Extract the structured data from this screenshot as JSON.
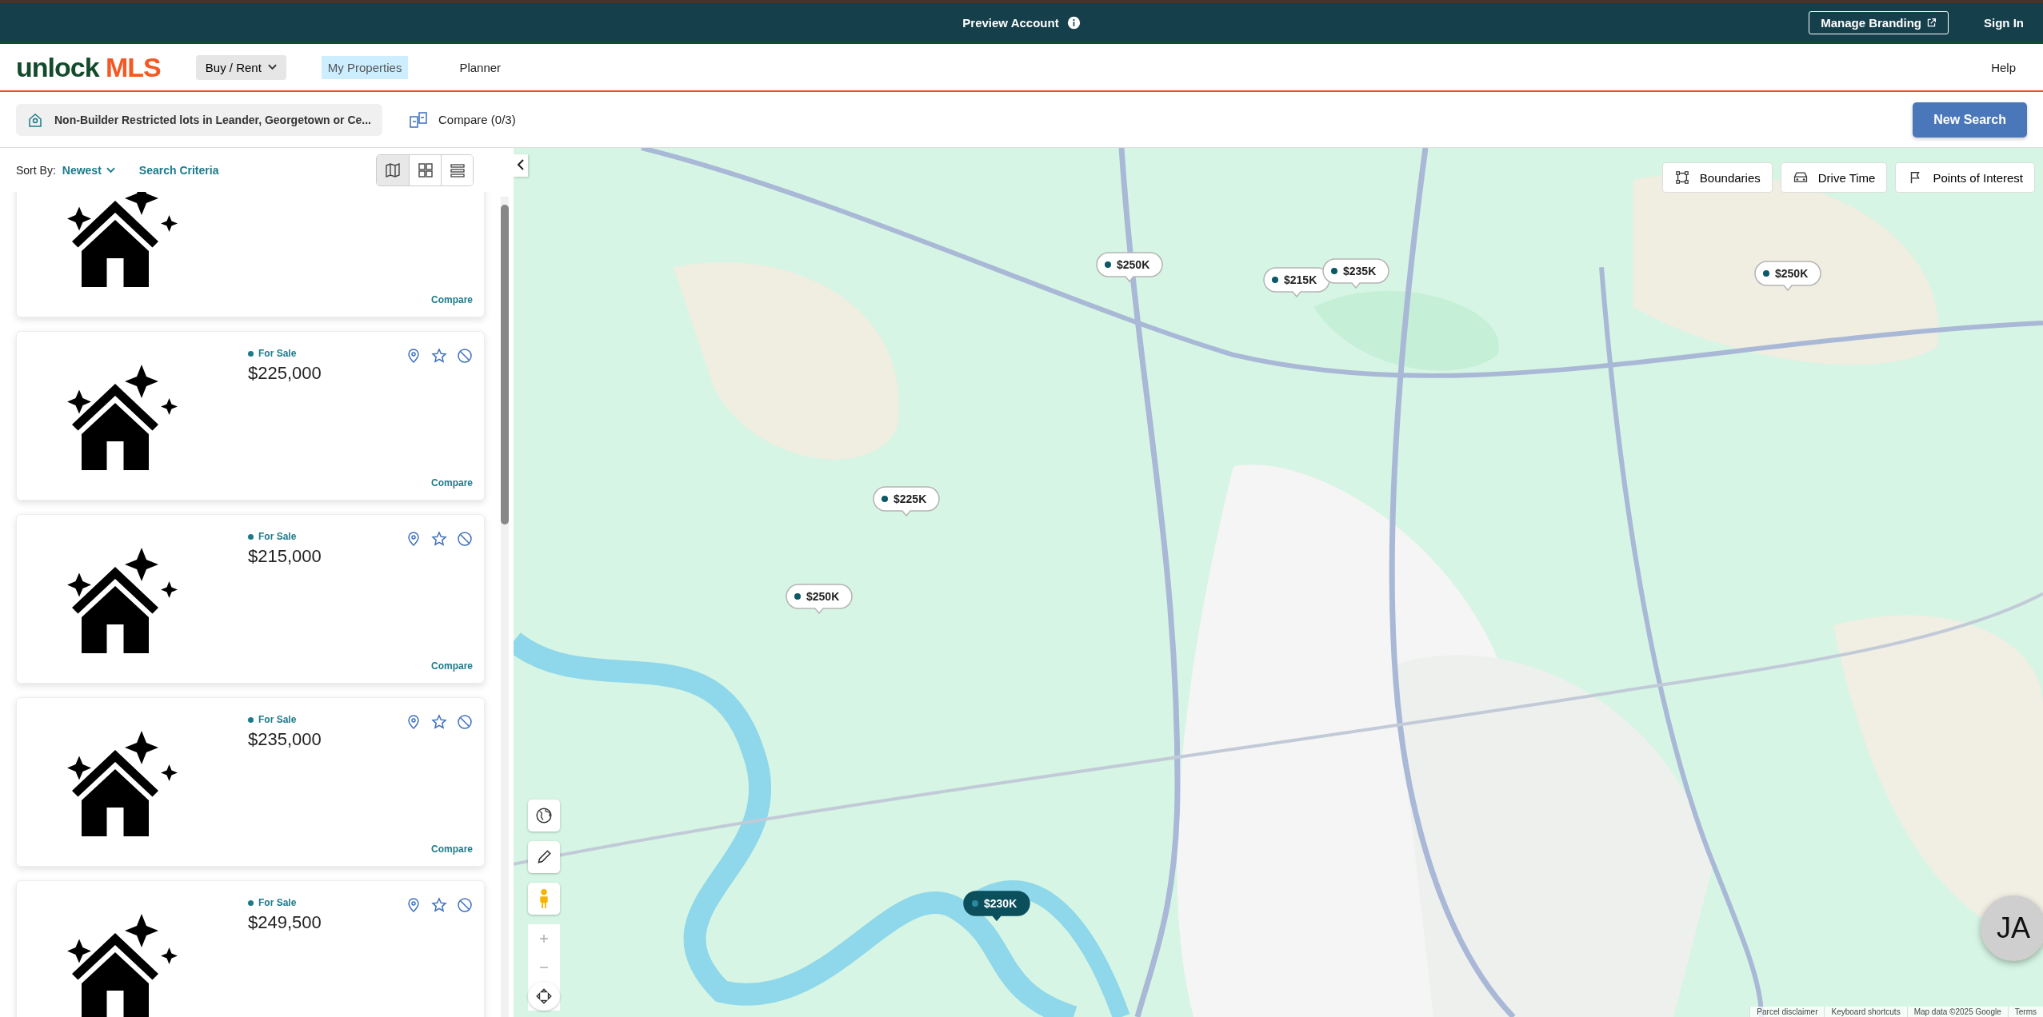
{
  "top_bar": {
    "title": "Preview Account",
    "manage_branding": "Manage Branding",
    "sign_in": "Sign In"
  },
  "nav": {
    "logo_primary": "unlock",
    "logo_accent": "MLS",
    "items": [
      {
        "label": "Buy / Rent",
        "kind": "dropdown",
        "selected": false
      },
      {
        "label": "My Properties",
        "kind": "link",
        "selected": true
      },
      {
        "label": "Planner",
        "kind": "link",
        "selected": false
      }
    ],
    "help": "Help"
  },
  "search_bar": {
    "saved_search": "Non-Builder Restricted lots in Leander, Georgetown or Ce...",
    "compare": "Compare (0/3)",
    "new_search": "New Search"
  },
  "list_header": {
    "sort_label": "Sort By:",
    "sort_value": "Newest",
    "search_criteria": "Search Criteria",
    "views": [
      {
        "kind": "map",
        "selected": true
      },
      {
        "kind": "grid",
        "selected": false
      },
      {
        "kind": "list",
        "selected": false
      }
    ]
  },
  "listings": [
    {
      "compare": "Compare"
    },
    {
      "status": "For Sale",
      "price": "$225,000",
      "compare": "Compare"
    },
    {
      "status": "For Sale",
      "price": "$215,000",
      "compare": "Compare"
    },
    {
      "status": "For Sale",
      "price": "$235,000",
      "compare": "Compare"
    },
    {
      "status": "For Sale",
      "price": "$249,500"
    }
  ],
  "map": {
    "tools": [
      {
        "label": "Boundaries",
        "kind": "boundaries"
      },
      {
        "label": "Drive Time",
        "kind": "drive"
      },
      {
        "label": "Points of Interest",
        "kind": "poi"
      }
    ],
    "markers": [
      {
        "price": "$250K",
        "selected": false
      },
      {
        "price": "$215K",
        "selected": false
      },
      {
        "price": "$235K",
        "selected": false
      },
      {
        "price": "$250K",
        "selected": false
      },
      {
        "price": "$225K",
        "selected": false
      },
      {
        "price": "$250K",
        "selected": false
      },
      {
        "price": "$230K",
        "selected": true
      }
    ],
    "footer": [
      "Parcel disclaimer",
      "Keyboard shortcuts",
      "Map data ©2025 Google",
      "Terms"
    ],
    "avatar": "JA"
  }
}
